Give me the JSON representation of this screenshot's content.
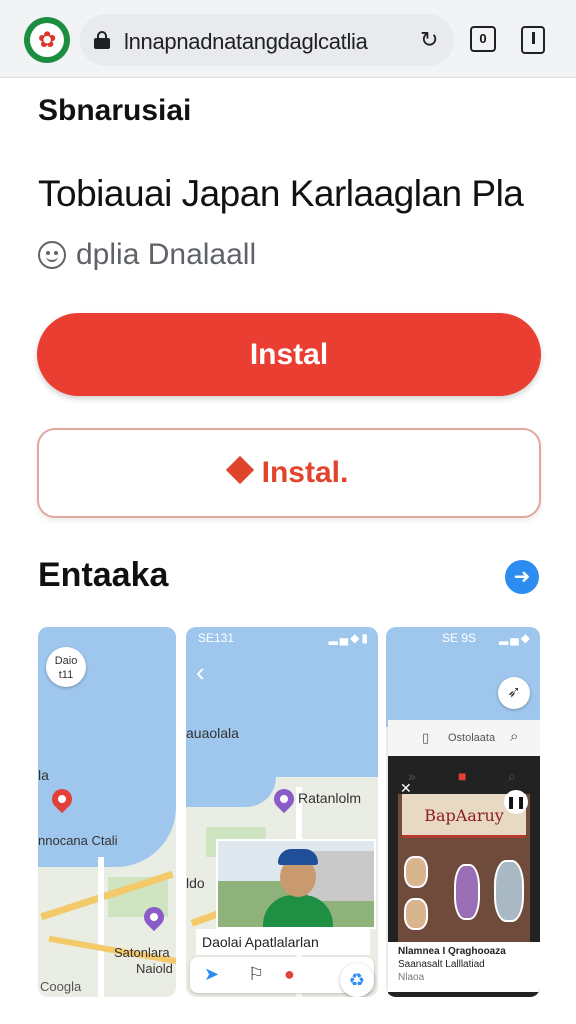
{
  "browser": {
    "url": "lnnapnadnatangdaglcatlia",
    "tab_count": "0"
  },
  "page": {
    "kicker": "Sbnarusiai",
    "app_title": "Tobiauai Japan Karlaaglan Pla",
    "rating_text": "dplia Dnalaall",
    "install_primary": "Instal",
    "install_secondary": "Instal.",
    "screens_heading": "Entaaka"
  },
  "screenshots": {
    "shot1": {
      "badge_line1": "Daio",
      "badge_line2": "t11",
      "label_coast": "nnocana Ctali",
      "label_bottom1": "Satonlara",
      "label_bottom2": "Naiold",
      "attribution": "Coogla",
      "edge_letter": "la"
    },
    "shot2": {
      "status_time": "SE131",
      "label_top": "auaolala",
      "label_pin": "Ratanlolm",
      "label_left": "ldo",
      "caption": "Daolai Apatlalarlan"
    },
    "shot3": {
      "status_time": "SE 9S",
      "header_title": "Ostolaata",
      "poster_sign": "BapAaruy",
      "info_line1": "Nlamnea I Qraghooaza",
      "info_line2": "Saanasalt Lalllatiad",
      "info_line3": "Nlaoa"
    }
  },
  "colors": {
    "accent_red": "#ea3e32",
    "install_text_red": "#e0442a",
    "link_blue": "#2d8cf0",
    "map_water": "#9fc7ee",
    "map_road": "#f3c96a"
  }
}
